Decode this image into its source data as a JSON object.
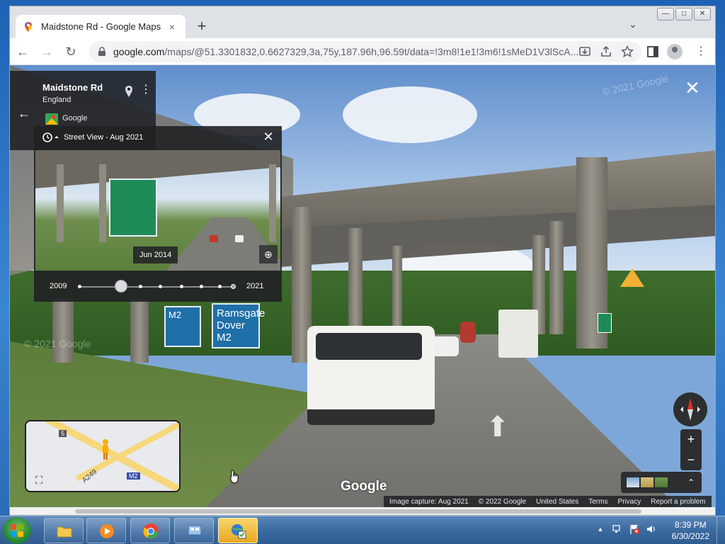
{
  "window": {
    "tab_title": "Maidstone Rd - Google Maps",
    "tab_close": "×",
    "new_tab": "+",
    "tab_list": "⌄",
    "minimize": "—",
    "maximize": "□",
    "close": "✕"
  },
  "toolbar": {
    "back": "←",
    "forward": "→",
    "reload": "↻",
    "url_host": "google.com",
    "url_path": "/maps/@51.3301832,0.6627329,3a,75y,187.96h,96.59t/data=!3m8!1e1!3m6!1sMeD1V3lScA...",
    "menu": "⋮"
  },
  "infocard": {
    "title": "Maidstone Rd",
    "subtitle": "England",
    "source": "Google",
    "back": "←",
    "more": "⋮"
  },
  "timepanel": {
    "title": "Street View - Aug 2021",
    "close": "✕",
    "thumb_date": "Jun 2014",
    "year_start": "2009",
    "year_end": "2021",
    "zoom": "⊕"
  },
  "streetview": {
    "close": "✕",
    "sign_line1": "Ramsgate",
    "sign_line2": "Dover",
    "sign_line3": "M2",
    "sign_left": "M2",
    "watermark1": "© 2021 Google",
    "watermark2": "© 2021 Google"
  },
  "minimap": {
    "shield1": "5",
    "shield2": "M2",
    "road_label": "A249",
    "expand": "⛶"
  },
  "controls": {
    "zoom_in": "+",
    "zoom_out": "−",
    "chevron": "⌃"
  },
  "footer": {
    "brand": "Google",
    "capture": "Image capture: Aug 2021",
    "copyright": "© 2022 Google",
    "region": "United States",
    "terms": "Terms",
    "privacy": "Privacy",
    "report": "Report a problem"
  },
  "taskbar": {
    "time": "8:39 PM",
    "date": "6/30/2022",
    "tray_up": "▲"
  },
  "colors": {
    "chrome_bg": "#dee1e6",
    "panel_bg": "#202124",
    "sign_blue": "#1f6fa8",
    "sign_green": "#1f8c58",
    "active_task": "#e8a820"
  }
}
